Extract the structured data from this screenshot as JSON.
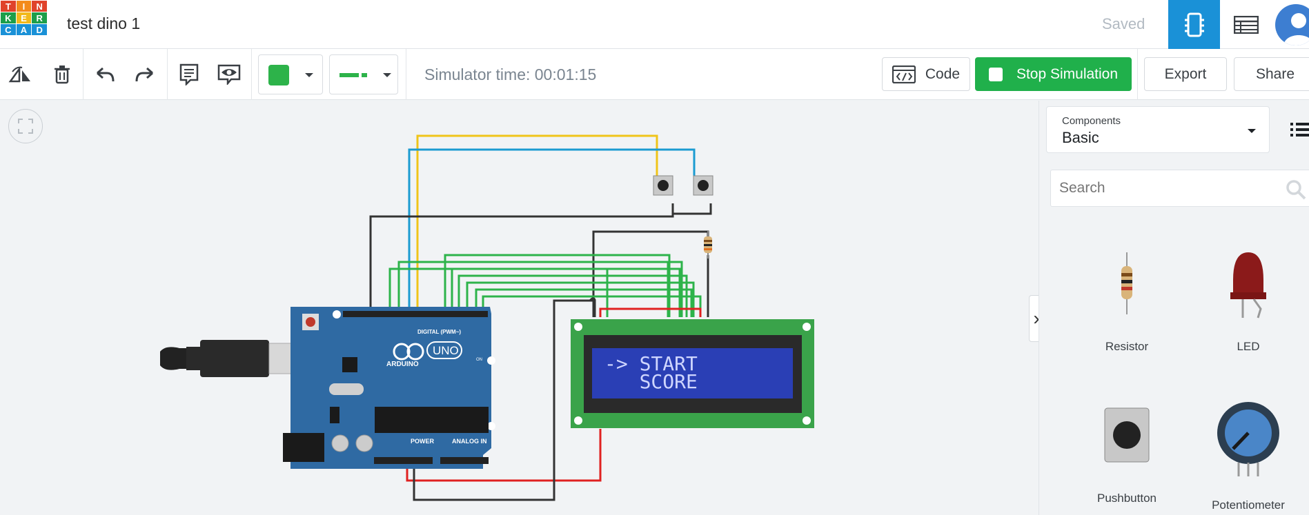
{
  "app": {
    "logo_letters": [
      "T",
      "I",
      "N",
      "K",
      "E",
      "R",
      "C",
      "A",
      "D"
    ],
    "logo_colors": [
      "#e0432b",
      "#f38b1c",
      "#e0432b",
      "#1d9e4a",
      "#f2b91c",
      "#1d9e4a",
      "#1a91d7",
      "#1a91d7",
      "#1a91d7"
    ],
    "project_title": "test dino 1",
    "save_status": "Saved"
  },
  "toolbar": {
    "simulator_time": "Simulator time: 00:01:15",
    "color_value": "#2db34a",
    "code_label": "Code",
    "stop_label": "Stop Simulation",
    "export_label": "Export",
    "share_label": "Share"
  },
  "lcd": {
    "line1": "-> START",
    "line2": "   SCORE"
  },
  "arduino": {
    "brand": "ARDUINO",
    "model": "UNO",
    "digital_label": "DIGITAL (PWM~)",
    "power_label": "POWER",
    "analog_label": "ANALOG IN",
    "on_label": "ON"
  },
  "panel": {
    "components_label": "Components",
    "components_value": "Basic",
    "search_placeholder": "Search",
    "items": [
      {
        "name": "Resistor"
      },
      {
        "name": "LED"
      },
      {
        "name": "Pushbutton"
      },
      {
        "name": "Potentiometer"
      }
    ]
  },
  "colors": {
    "accent_blue": "#1a91d7",
    "run_green": "#20b04b",
    "arduino_blue": "#2f6aa3",
    "lcd_green": "#3aa34a",
    "lcd_screen": "#2a3fb5"
  }
}
